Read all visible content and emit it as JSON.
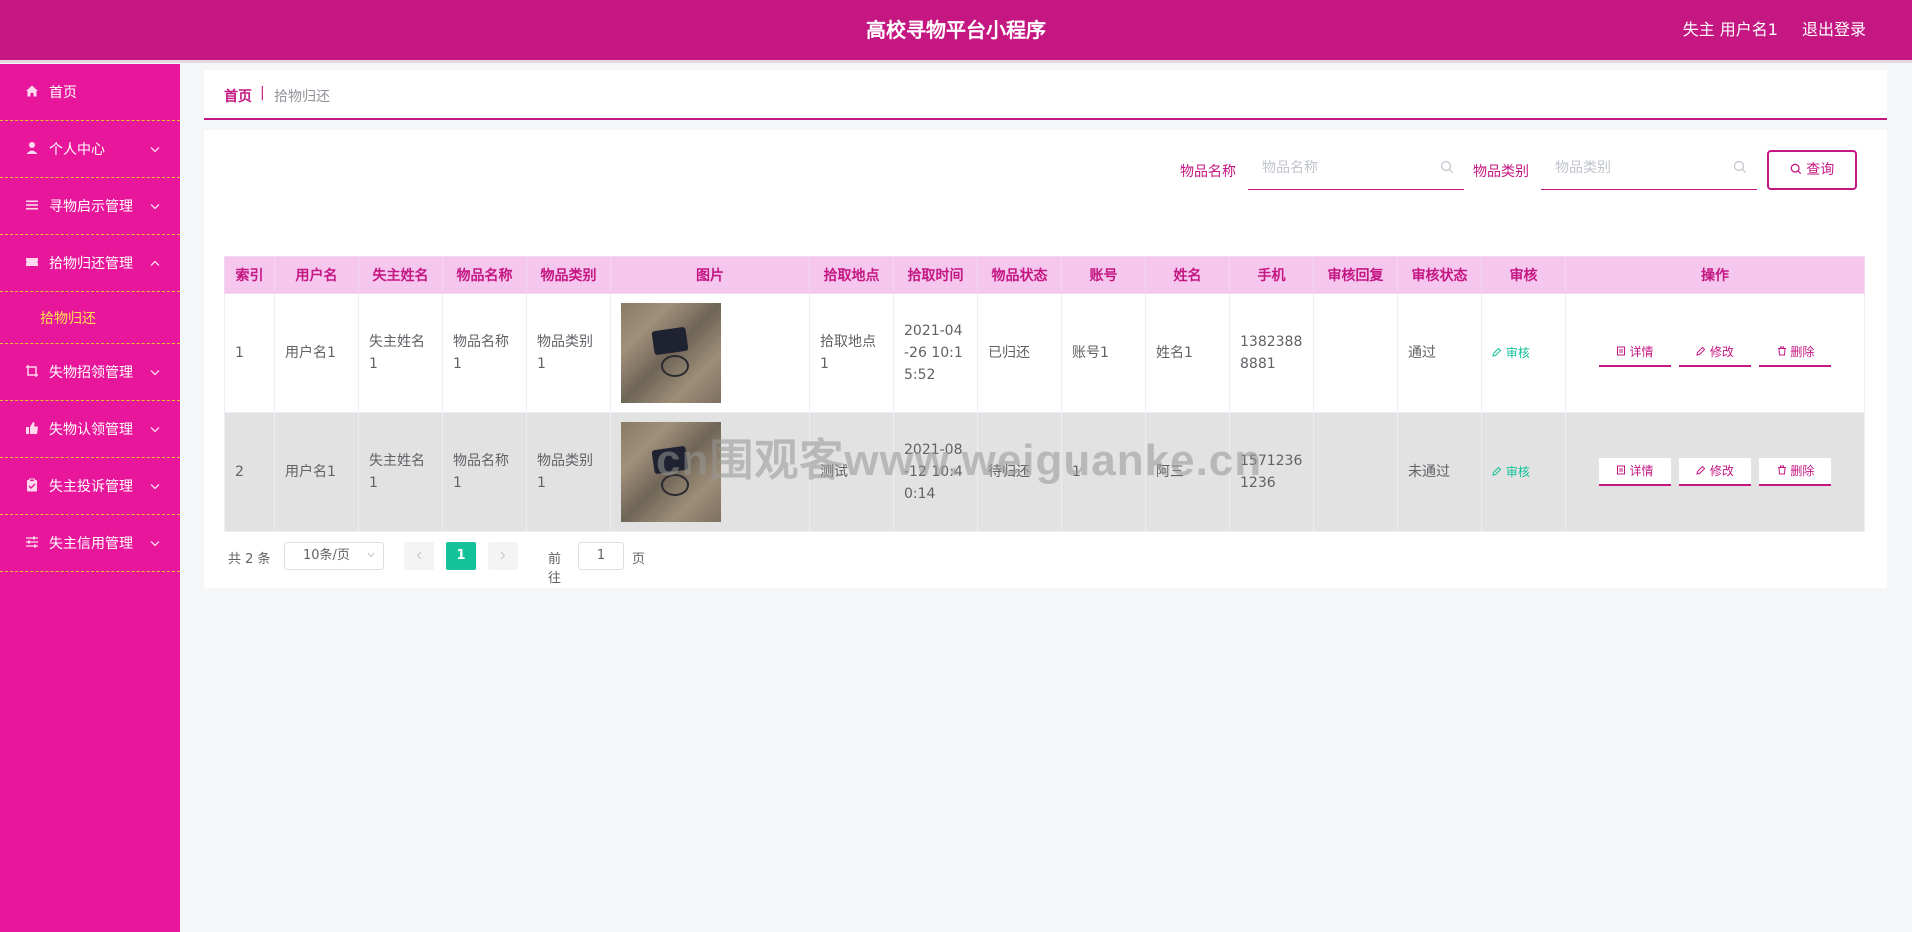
{
  "header": {
    "title": "高校寻物平台小程序",
    "user": "失主 用户名1",
    "logout": "退出登录"
  },
  "sidebar": {
    "items": [
      {
        "label": "首页",
        "icon": "home-icon"
      },
      {
        "label": "个人中心",
        "icon": "user-icon"
      },
      {
        "label": "寻物启示管理",
        "icon": "list-icon"
      },
      {
        "label": "拾物归还管理",
        "icon": "ticket-icon",
        "expanded": true
      },
      {
        "label": "失物招领管理",
        "icon": "crop-icon"
      },
      {
        "label": "失物认领管理",
        "icon": "thumb-icon"
      },
      {
        "label": "失主投诉管理",
        "icon": "clipboard-icon"
      },
      {
        "label": "失主信用管理",
        "icon": "sliders-icon"
      }
    ],
    "sub_item": "拾物归还"
  },
  "breadcrumb": {
    "home": "首页",
    "separator": "|",
    "current": "拾物归还"
  },
  "search": {
    "name_label": "物品名称",
    "name_placeholder": "物品名称",
    "category_label": "物品类别",
    "category_placeholder": "物品类别",
    "query_button": "查询"
  },
  "table": {
    "headers": [
      "索引",
      "用户名",
      "失主姓名",
      "物品名称",
      "物品类别",
      "图片",
      "拾取地点",
      "拾取时间",
      "物品状态",
      "账号",
      "姓名",
      "手机",
      "审核回复",
      "审核状态",
      "审核",
      "操作"
    ],
    "rows": [
      {
        "index": "1",
        "username": "用户名1",
        "owner": "失主姓名1",
        "item": "物品名称1",
        "category": "物品类别1",
        "location": "拾取地点1",
        "time": "2021-04-26 10:15:52",
        "status": "已归还",
        "account": "账号1",
        "name": "姓名1",
        "phone": "13823888881",
        "reply": "",
        "audit_status": "通过"
      },
      {
        "index": "2",
        "username": "用户名1",
        "owner": "失主姓名1",
        "item": "物品名称1",
        "category": "物品类别1",
        "location": "测试",
        "time": "2021-08-12 10:40:14",
        "status": "待归还",
        "account": "1",
        "name": "阿三",
        "phone": "15712361236",
        "reply": "",
        "audit_status": "未通过"
      }
    ],
    "audit_link": "审核",
    "btn_detail": "详情",
    "btn_edit": "修改",
    "btn_delete": "删除"
  },
  "pagination": {
    "total": "共 2 条",
    "page_size": "10条/页",
    "current": "1",
    "goto_prefix": "前往",
    "goto_value": "1",
    "goto_suffix": "页"
  },
  "watermark": "cn围观客www.weiguanke.cn",
  "colors": {
    "header": "#c41782",
    "sidebar": "#e8169a",
    "sidebar_divider": "#f0c02e",
    "accent": "#c41782",
    "table_header": "#f5c7ef",
    "success": "#13c29a"
  }
}
